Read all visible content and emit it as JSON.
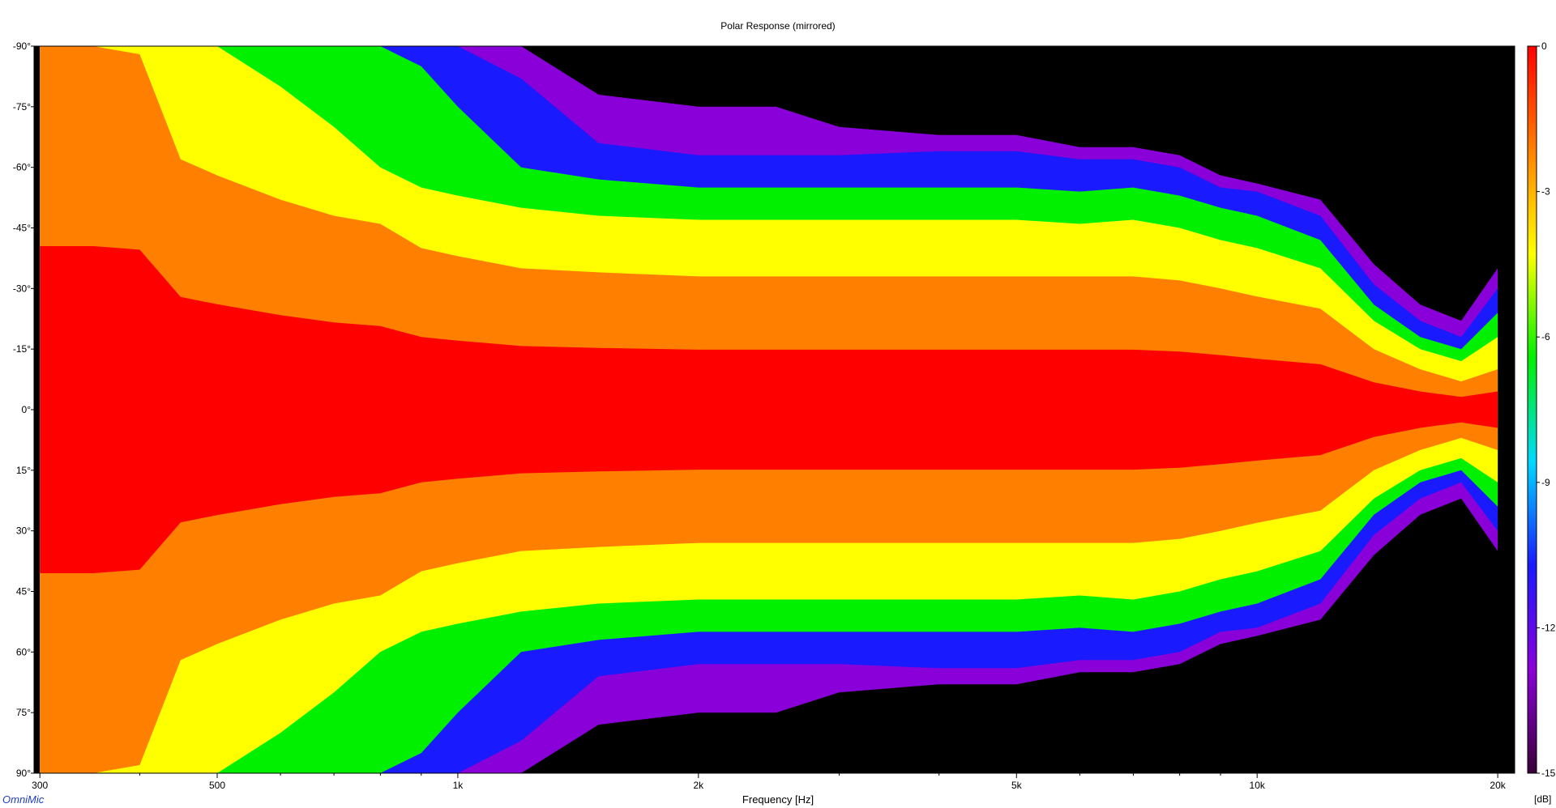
{
  "chart_data": {
    "type": "heatmap",
    "title": "Polar Response (mirrored)",
    "xlabel": "Frequency [Hz]",
    "ylabel": "",
    "x_scale": "log",
    "xlim": [
      295,
      21000
    ],
    "ylim": [
      -90,
      90
    ],
    "x_ticks": [
      {
        "value": 300,
        "label": "300"
      },
      {
        "value": 500,
        "label": "500"
      },
      {
        "value": 1000,
        "label": "1k"
      },
      {
        "value": 2000,
        "label": "2k"
      },
      {
        "value": 5000,
        "label": "5k"
      },
      {
        "value": 10000,
        "label": "10k"
      },
      {
        "value": 20000,
        "label": "20k"
      }
    ],
    "y_ticks": [
      {
        "value": -90,
        "label": "-90°"
      },
      {
        "value": -75,
        "label": "-75°"
      },
      {
        "value": -60,
        "label": "-60°"
      },
      {
        "value": -45,
        "label": "-45°"
      },
      {
        "value": -30,
        "label": "-30°"
      },
      {
        "value": -15,
        "label": "-15°"
      },
      {
        "value": 0,
        "label": "0°"
      },
      {
        "value": 15,
        "label": "15°"
      },
      {
        "value": 30,
        "label": "30°"
      },
      {
        "value": 45,
        "label": "45°"
      },
      {
        "value": 60,
        "label": "60°"
      },
      {
        "value": 75,
        "label": "75°"
      },
      {
        "value": 90,
        "label": "90°"
      }
    ],
    "colorbar": {
      "unit": "[dB]",
      "range": [
        -15,
        0
      ],
      "ticks": [
        {
          "value": 0,
          "label": "0"
        },
        {
          "value": -3,
          "label": "-3"
        },
        {
          "value": -6,
          "label": "-6"
        },
        {
          "value": -9,
          "label": "-9"
        },
        {
          "value": -12,
          "label": "-12"
        },
        {
          "value": -15,
          "label": "-15"
        }
      ],
      "colors": [
        "#3a0038",
        "#8a00d8",
        "#1a1aff",
        "#00d8ff",
        "#00f000",
        "#ffff00",
        "#ff8000",
        "#ff0000"
      ],
      "below_range_color": "#000000"
    },
    "contours": {
      "frequencies": [
        300,
        350,
        400,
        450,
        500,
        600,
        700,
        800,
        900,
        1000,
        1200,
        1500,
        2000,
        2500,
        3000,
        4000,
        5000,
        6000,
        7000,
        8000,
        9000,
        10000,
        12000,
        14000,
        16000,
        18000,
        20000
      ],
      "angle_at_minus_3dB": [
        90,
        90,
        88,
        62,
        58,
        52,
        48,
        46,
        40,
        38,
        35,
        34,
        33,
        33,
        33,
        33,
        33,
        33,
        33,
        32,
        30,
        28,
        25,
        15,
        10,
        7,
        10
      ],
      "angle_at_minus_6dB": [
        90,
        90,
        90,
        90,
        90,
        80,
        70,
        60,
        55,
        53,
        50,
        48,
        47,
        47,
        47,
        47,
        47,
        46,
        47,
        45,
        42,
        40,
        35,
        22,
        15,
        12,
        18
      ],
      "angle_at_minus_9dB": [
        90,
        90,
        90,
        90,
        90,
        90,
        90,
        90,
        85,
        75,
        60,
        57,
        55,
        55,
        55,
        55,
        55,
        54,
        55,
        53,
        50,
        48,
        42,
        26,
        18,
        15,
        24
      ],
      "angle_at_minus_12dB": [
        90,
        90,
        90,
        90,
        90,
        90,
        90,
        90,
        90,
        90,
        82,
        66,
        63,
        63,
        63,
        64,
        64,
        62,
        62,
        60,
        55,
        54,
        48,
        31,
        22,
        18,
        30
      ],
      "angle_at_minus_15dB": [
        90,
        90,
        90,
        90,
        90,
        90,
        90,
        90,
        90,
        90,
        90,
        78,
        75,
        75,
        70,
        68,
        68,
        65,
        65,
        63,
        58,
        56,
        52,
        36,
        26,
        22,
        35
      ]
    }
  },
  "branding": {
    "label": "OmniMic"
  }
}
